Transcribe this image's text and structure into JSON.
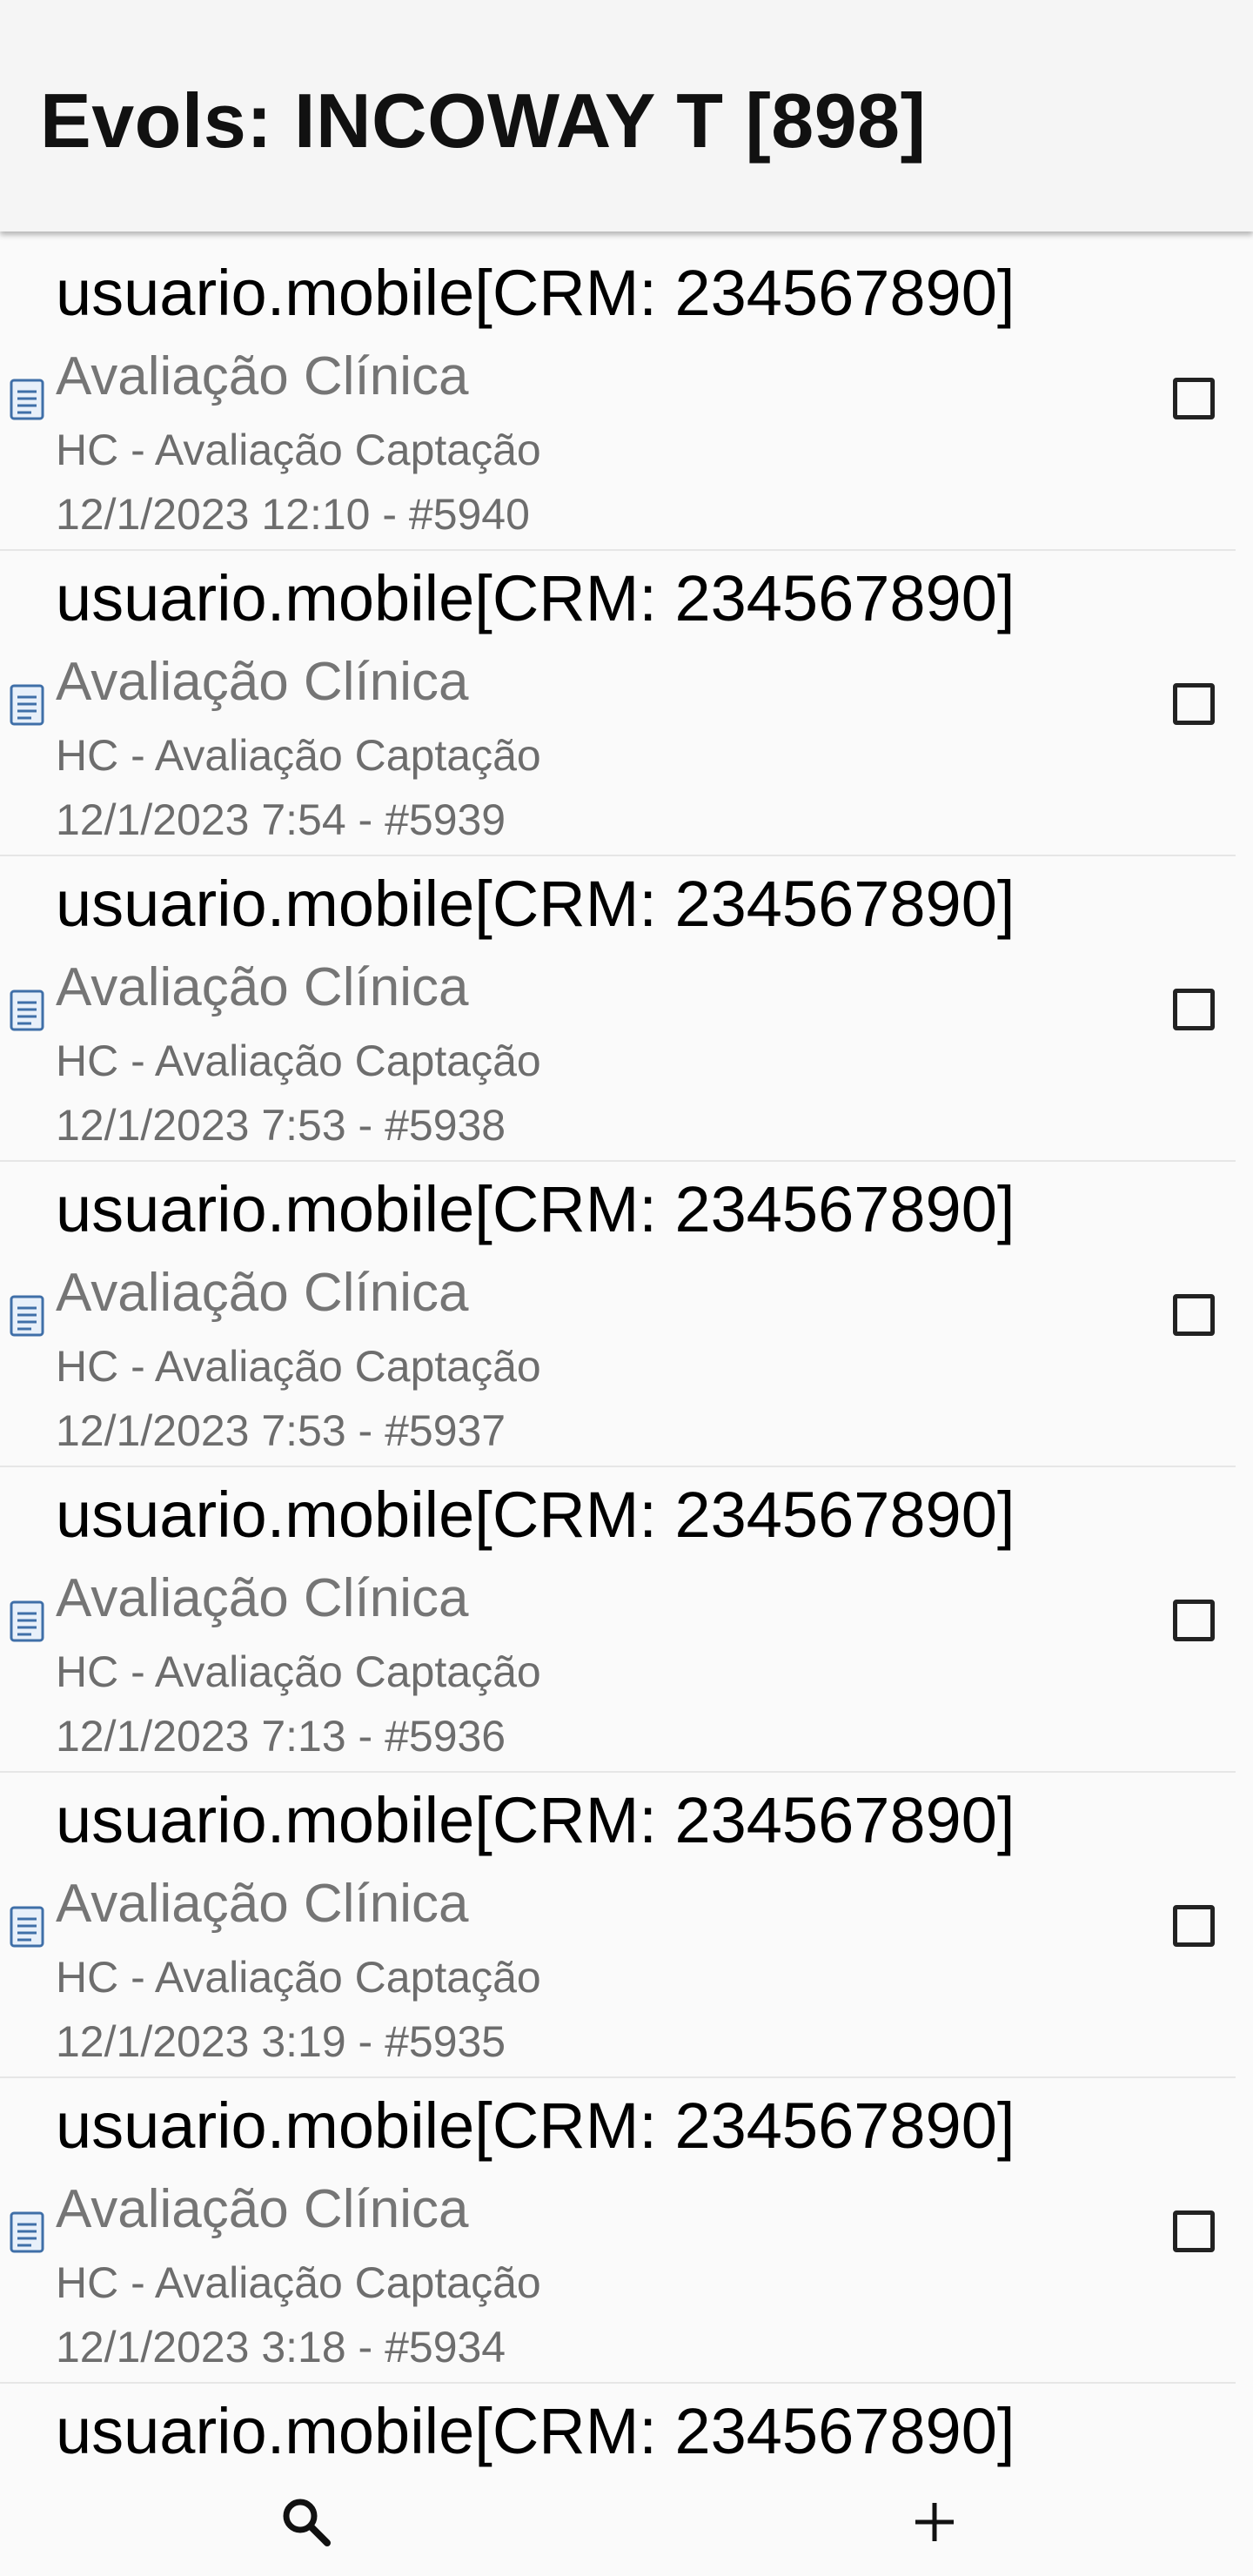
{
  "header": {
    "title": "Evols: INCOWAY T [898]"
  },
  "items": [
    {
      "title": "usuario.mobile[CRM: 234567890]",
      "subtitle": "Avaliação Clínica",
      "form": "HC - Avaliação Captação",
      "date": "12/1/2023 12:10 - #5940",
      "checked": false
    },
    {
      "title": "usuario.mobile[CRM: 234567890]",
      "subtitle": "Avaliação Clínica",
      "form": "HC - Avaliação Captação",
      "date": "12/1/2023 7:54 - #5939",
      "checked": false
    },
    {
      "title": "usuario.mobile[CRM: 234567890]",
      "subtitle": "Avaliação Clínica",
      "form": "HC - Avaliação Captação",
      "date": "12/1/2023 7:53 - #5938",
      "checked": false
    },
    {
      "title": "usuario.mobile[CRM: 234567890]",
      "subtitle": "Avaliação Clínica",
      "form": "HC - Avaliação Captação",
      "date": "12/1/2023 7:53 - #5937",
      "checked": false
    },
    {
      "title": "usuario.mobile[CRM: 234567890]",
      "subtitle": "Avaliação Clínica",
      "form": "HC - Avaliação Captação",
      "date": "12/1/2023 7:13 - #5936",
      "checked": false
    },
    {
      "title": "usuario.mobile[CRM: 234567890]",
      "subtitle": "Avaliação Clínica",
      "form": "HC - Avaliação Captação",
      "date": "12/1/2023 3:19 - #5935",
      "checked": false
    },
    {
      "title": "usuario.mobile[CRM: 234567890]",
      "subtitle": "Avaliação Clínica",
      "form": "HC - Avaliação Captação",
      "date": "12/1/2023 3:18 - #5934",
      "checked": false
    },
    {
      "title": "usuario.mobile[CRM: 234567890]"
    }
  ],
  "bottom_bar": {
    "search_icon": "search-icon",
    "add_icon": "plus-icon"
  },
  "colors": {
    "header_bg": "#f5f5f5",
    "title_text": "#000000",
    "subtitle_text": "#757575",
    "meta_text": "#6d6d6d",
    "doc_icon": "#3f6fa8"
  }
}
